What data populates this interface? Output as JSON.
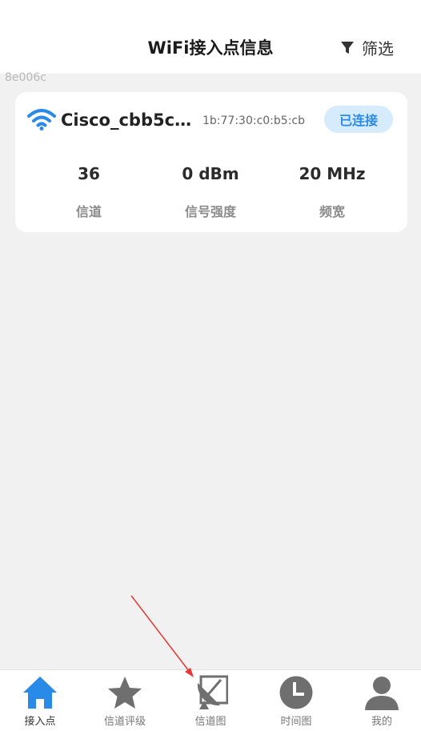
{
  "header": {
    "title": "WiFi接入点信息",
    "filter_label": "筛选"
  },
  "debug_tag": "8e006c",
  "access_point": {
    "ssid": "Cisco_cbb5c0...",
    "bssid": "1b:77:30:c0:b5:cb",
    "status": "已连接",
    "stats": [
      {
        "value": "36",
        "label": "信道"
      },
      {
        "value": "0 dBm",
        "label": "信号强度"
      },
      {
        "value": "20 MHz",
        "label": "频宽"
      }
    ]
  },
  "bottom_nav": [
    {
      "label": "接入点",
      "icon": "home-icon",
      "active": true
    },
    {
      "label": "信道评级",
      "icon": "star-icon",
      "active": false
    },
    {
      "label": "信道图",
      "icon": "satellite-dish-icon",
      "active": false
    },
    {
      "label": "时间图",
      "icon": "clock-icon",
      "active": false
    },
    {
      "label": "我的",
      "icon": "user-icon",
      "active": false
    }
  ],
  "colors": {
    "accent": "#2a8ae8",
    "badge_bg": "#d6ebfb",
    "background": "#f1f1f1",
    "annotation_arrow": "#e53935"
  }
}
